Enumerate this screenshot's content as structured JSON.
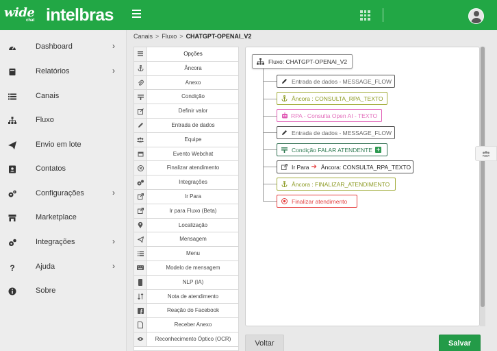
{
  "header": {
    "brand_wide": "wide",
    "brand_chat": "chat",
    "brand_intelbras": "intelbras",
    "icons": [
      "menu-icon",
      "apps-grid-icon",
      "user-avatar-icon"
    ]
  },
  "sidebar": {
    "items": [
      {
        "label": "Dashboard",
        "icon": "speedometer-icon",
        "has_submenu": true
      },
      {
        "label": "Relatórios",
        "icon": "book-icon",
        "has_submenu": true
      },
      {
        "label": "Canais",
        "icon": "list-icon",
        "has_submenu": false
      },
      {
        "label": "Fluxo",
        "icon": "sitemap-icon",
        "has_submenu": false
      },
      {
        "label": "Envio em lote",
        "icon": "paper-plane-icon",
        "has_submenu": false
      },
      {
        "label": "Contatos",
        "icon": "contact-card-icon",
        "has_submenu": false
      },
      {
        "label": "Configurações",
        "icon": "gears-icon",
        "has_submenu": true
      },
      {
        "label": "Marketplace",
        "icon": "store-icon",
        "has_submenu": false
      },
      {
        "label": "Integrações",
        "icon": "cogs-icon",
        "has_submenu": true
      },
      {
        "label": "Ajuda",
        "icon": "question-icon",
        "has_submenu": true
      },
      {
        "label": "Sobre",
        "icon": "info-icon",
        "has_submenu": false
      }
    ],
    "chevron": "›"
  },
  "breadcrumb": {
    "items": [
      "Canais",
      "Fluxo",
      "CHATGPT-OPENAI_V2"
    ],
    "separator": ">"
  },
  "options": {
    "header": "Opções",
    "items": [
      {
        "label": "Âncora",
        "icon": "anchor-icon"
      },
      {
        "label": "Anexo",
        "icon": "paperclip-icon"
      },
      {
        "label": "Condição",
        "icon": "condition-icon"
      },
      {
        "label": "Definir valor",
        "icon": "edit-icon"
      },
      {
        "label": "Entrada de dados",
        "icon": "pencil-icon"
      },
      {
        "label": "Equipe",
        "icon": "team-icon"
      },
      {
        "label": "Evento Webchat",
        "icon": "calendar-icon"
      },
      {
        "label": "Finalizar atendimento",
        "icon": "stop-circle-icon"
      },
      {
        "label": "Integrações",
        "icon": "cogs-icon"
      },
      {
        "label": "Ir Para",
        "icon": "external-link-icon"
      },
      {
        "label": "Ir para Fluxo (Beta)",
        "icon": "external-link-icon"
      },
      {
        "label": "Localização",
        "icon": "map-pin-icon"
      },
      {
        "label": "Mensagem",
        "icon": "send-icon"
      },
      {
        "label": "Menu",
        "icon": "list-icon"
      },
      {
        "label": "Modelo de mensagem",
        "icon": "keyboard-icon"
      },
      {
        "label": "NLP (IA)",
        "icon": "phone-icon"
      },
      {
        "label": "Nota de atendimento",
        "icon": "sort-icon"
      },
      {
        "label": "Reação do Facebook",
        "icon": "facebook-icon"
      },
      {
        "label": "Receber Anexo",
        "icon": "file-icon"
      },
      {
        "label": "Reconhecimento Óptico (OCR)",
        "icon": "eye-icon"
      }
    ]
  },
  "flow": {
    "root": {
      "label": "Fluxo: CHATGPT-OPENAI_V2",
      "icon": "sitemap-icon"
    },
    "nodes": [
      {
        "label": "Entrada de dados - MESSAGE_FLOW",
        "kind": "input",
        "icon": "pencil-icon",
        "color": "#555555"
      },
      {
        "label": "Âncora : CONSULTA_RPA_TEXTO",
        "kind": "anchor",
        "icon": "anchor-icon",
        "color": "#a2ac3b"
      },
      {
        "label": "RPA - Consulta Open AI - TEXTO",
        "kind": "rpa",
        "icon": "robot-icon",
        "color": "#e05ab4"
      },
      {
        "label": "Entrada de dados - MESSAGE_FLOW",
        "kind": "input",
        "icon": "pencil-icon",
        "color": "#555555"
      },
      {
        "label": "Condição FALAR ATENDENTE",
        "kind": "condition",
        "icon": "condition-icon",
        "color": "#2d6d4f",
        "expand": "+"
      },
      {
        "label": "Ir Para",
        "target": "Âncora: CONSULTA_RPA_TEXTO",
        "kind": "goto",
        "icon": "external-link-icon",
        "color": "#555555",
        "arrow": "➔"
      },
      {
        "label": "Âncora : FINALIZAR_ATENDIMENTO",
        "kind": "anchor",
        "icon": "anchor-icon",
        "color": "#a2ac3b"
      },
      {
        "label": "Finalizar atendimento",
        "kind": "end",
        "icon": "stop-circle-icon",
        "color": "#e53e3e"
      }
    ]
  },
  "actions": {
    "back_label": "Voltar",
    "save_label": "Salvar"
  },
  "colors": {
    "primary": "#22a745",
    "save": "#239b48"
  }
}
